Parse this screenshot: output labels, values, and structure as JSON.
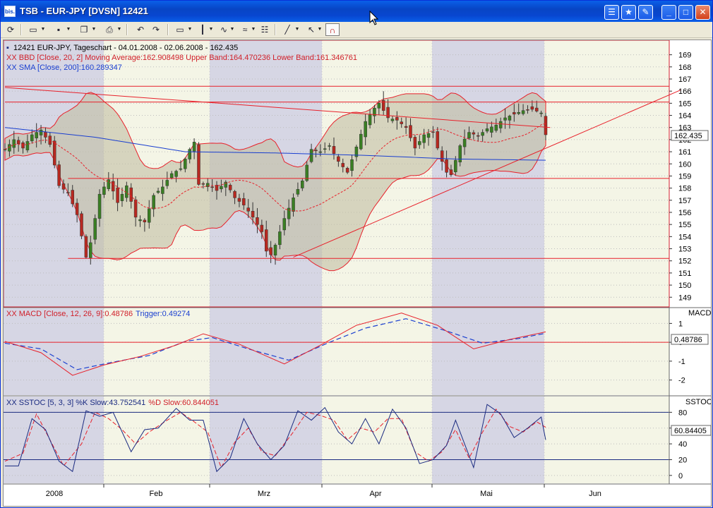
{
  "window": {
    "title": "TSB - EUR-JPY [DVSN] 12421",
    "app_icon": "bis."
  },
  "colors": {
    "title_bar": "#0a5fe8",
    "price_red": "#e8202a",
    "sma_blue": "#1a3fd0",
    "band_fill": "#c4c0a4",
    "shade_gray": "#d6d6e4",
    "shade_cream": "#f4f5e6",
    "up_candle": "#3a7f23",
    "down_candle": "#b82820"
  },
  "toolbar": {
    "icons": [
      "refresh-icon",
      "open-folder-icon",
      "save-icon",
      "copy-icon",
      "print-icon",
      "undo-icon",
      "redo-icon",
      "chart-type-icon",
      "candle-icon",
      "indicator-icon",
      "compare-icon",
      "properties-icon",
      "draw-line-icon",
      "pointer-icon",
      "magnet-icon"
    ]
  },
  "main": {
    "legend_title": "12421  EUR-JPY, Tageschart - 04.01.2008 - 02.06.2008 - 162.435",
    "legend_bbd": "XX BBD [Close, 20, 2] Moving Average:162.908498 Upper Band:164.470236 Lower Band:161.346761",
    "legend_sma": "XX SMA [Close, 200]:160.289347",
    "last_price": "162.435"
  },
  "macd": {
    "panel_label": "MACD",
    "legend_name": "XX MACD [Close, 12, 26, 9]:0.48786",
    "legend_trigger": "Trigger:0.49274",
    "last_value": "0.48786"
  },
  "sstoc": {
    "panel_label": "SSTOC",
    "legend_k": "XX SSTOC [5, 3, 3] %K Slow:43.752541",
    "legend_d": "%D Slow:60.844051",
    "last_value": "60.84405"
  },
  "chart_data": [
    {
      "type": "line",
      "title": "12421  EUR-JPY, Tageschart - 04.01.2008 - 02.06.2008 - 162.435",
      "xlabel": "",
      "ylabel": "",
      "x_axis_labels": [
        "2008",
        "Feb",
        "Mrz",
        "Apr",
        "Mai",
        "Jun"
      ],
      "y_axis": {
        "ticks": [
          149,
          150,
          151,
          152,
          153,
          154,
          155,
          156,
          157,
          158,
          159,
          160,
          161,
          162,
          163,
          164,
          165,
          166,
          167,
          168,
          169
        ],
        "ylim": [
          148.2,
          170.2
        ],
        "position": "right",
        "grid": true
      },
      "series": [
        {
          "name": "XX BBD [Close, 20, 2] Moving Average",
          "last_value": 162.908498
        },
        {
          "name": "Upper Band",
          "last_value": 164.470236
        },
        {
          "name": "Lower Band",
          "last_value": 161.346761
        },
        {
          "name": "XX SMA [Close, 200]",
          "last_value": 160.289347
        }
      ],
      "close_path": [
        [
          0,
          161.2
        ],
        [
          2,
          162.0
        ],
        [
          4,
          161.3
        ],
        [
          6,
          162.4
        ],
        [
          8,
          162.8
        ],
        [
          10,
          161.6
        ],
        [
          12,
          158.2
        ],
        [
          14,
          157.6
        ],
        [
          16,
          155.8
        ],
        [
          18,
          152.3
        ],
        [
          19,
          153.5
        ],
        [
          21,
          157.5
        ],
        [
          23,
          158.7
        ],
        [
          25,
          156.8
        ],
        [
          27,
          158.2
        ],
        [
          29,
          155.6
        ],
        [
          31,
          155.2
        ],
        [
          33,
          157.4
        ],
        [
          35,
          158.1
        ],
        [
          37,
          159.2
        ],
        [
          39,
          159.6
        ],
        [
          41,
          161.2
        ],
        [
          42,
          161.8
        ],
        [
          43,
          158.3
        ],
        [
          45,
          158.4
        ],
        [
          47,
          157.8
        ],
        [
          49,
          158.5
        ],
        [
          51,
          157.2
        ],
        [
          53,
          156.6
        ],
        [
          55,
          155.6
        ],
        [
          57,
          154.4
        ],
        [
          58,
          152.8
        ],
        [
          59,
          152.5
        ],
        [
          60,
          153.3
        ],
        [
          62,
          155.5
        ],
        [
          64,
          157.2
        ],
        [
          66,
          158.6
        ],
        [
          68,
          161.2
        ],
        [
          70,
          161.0
        ],
        [
          72,
          161.5
        ],
        [
          74,
          160.2
        ],
        [
          76,
          159.3
        ],
        [
          78,
          161.4
        ],
        [
          80,
          163.5
        ],
        [
          82,
          164.6
        ],
        [
          83,
          165.0
        ],
        [
          85,
          163.8
        ],
        [
          87,
          163.6
        ],
        [
          89,
          163.0
        ],
        [
          91,
          161.3
        ],
        [
          93,
          162.4
        ],
        [
          95,
          162.6
        ],
        [
          96,
          161.3
        ],
        [
          97,
          160.2
        ],
        [
          98,
          159.3
        ],
        [
          99,
          159.1
        ],
        [
          101,
          161.5
        ],
        [
          103,
          162.6
        ],
        [
          105,
          162.3
        ],
        [
          107,
          162.9
        ],
        [
          109,
          163.2
        ],
        [
          111,
          163.8
        ],
        [
          113,
          164.1
        ],
        [
          115,
          164.4
        ],
        [
          117,
          164.5
        ],
        [
          119,
          164.2
        ],
        [
          120,
          162.4
        ]
      ],
      "horizontal_lines": [
        166.4,
        165.1,
        158.8,
        152.2
      ],
      "trendlines": [
        {
          "from": [
            0,
            166.3
          ],
          "to": [
            121,
            163.0
          ]
        },
        {
          "from": [
            64,
            152.3
          ],
          "to": [
            150,
            166.1
          ]
        }
      ]
    },
    {
      "type": "line",
      "title": "XX MACD [Close, 12, 26, 9]:0.48786",
      "y_axis": {
        "ticks": [
          -2,
          -1,
          0,
          1
        ],
        "ylim": [
          -2.8,
          1.8
        ],
        "position": "right"
      },
      "series": [
        {
          "name": "XX MACD [Close, 12, 26, 9]",
          "last_value": 0.48786,
          "points": [
            [
              0,
              0.05
            ],
            [
              8,
              -0.55
            ],
            [
              15,
              -1.75
            ],
            [
              22,
              -1.2
            ],
            [
              30,
              -0.75
            ],
            [
              38,
              -0.15
            ],
            [
              44,
              0.45
            ],
            [
              52,
              -0.1
            ],
            [
              62,
              -1.15
            ],
            [
              70,
              -0.15
            ],
            [
              78,
              0.9
            ],
            [
              88,
              1.55
            ],
            [
              96,
              0.9
            ],
            [
              104,
              -0.35
            ],
            [
              112,
              0.15
            ],
            [
              120,
              0.55
            ]
          ]
        },
        {
          "name": "Trigger",
          "last_value": 0.49274,
          "points": [
            [
              0,
              -0.05
            ],
            [
              8,
              -0.35
            ],
            [
              16,
              -1.45
            ],
            [
              24,
              -1.05
            ],
            [
              32,
              -0.7
            ],
            [
              40,
              0.05
            ],
            [
              46,
              0.25
            ],
            [
              54,
              -0.35
            ],
            [
              63,
              -0.95
            ],
            [
              72,
              0.0
            ],
            [
              80,
              0.75
            ],
            [
              89,
              1.25
            ],
            [
              98,
              0.6
            ],
            [
              106,
              -0.05
            ],
            [
              114,
              0.2
            ],
            [
              120,
              0.48
            ]
          ]
        }
      ],
      "horizontal_lines": [
        0
      ]
    },
    {
      "type": "line",
      "title": "XX SSTOC [5, 3, 3] %K Slow:43.752541",
      "y_axis": {
        "ticks": [
          0,
          20,
          40,
          60,
          80
        ],
        "ylim": [
          -10,
          100
        ],
        "position": "right"
      },
      "series": [
        {
          "name": "%K Slow",
          "last_value": 43.752541,
          "points": [
            [
              0,
              12
            ],
            [
              3,
              12
            ],
            [
              6,
              72
            ],
            [
              9,
              58
            ],
            [
              12,
              18
            ],
            [
              15,
              5
            ],
            [
              18,
              82
            ],
            [
              21,
              75
            ],
            [
              24,
              80
            ],
            [
              28,
              30
            ],
            [
              31,
              58
            ],
            [
              34,
              60
            ],
            [
              38,
              85
            ],
            [
              41,
              70
            ],
            [
              44,
              70
            ],
            [
              47,
              5
            ],
            [
              50,
              22
            ],
            [
              53,
              72
            ],
            [
              56,
              40
            ],
            [
              59,
              20
            ],
            [
              62,
              38
            ],
            [
              65,
              82
            ],
            [
              68,
              70
            ],
            [
              71,
              86
            ],
            [
              74,
              55
            ],
            [
              77,
              40
            ],
            [
              80,
              72
            ],
            [
              83,
              40
            ],
            [
              86,
              84
            ],
            [
              89,
              60
            ],
            [
              92,
              15
            ],
            [
              95,
              20
            ],
            [
              98,
              38
            ],
            [
              100,
              70
            ],
            [
              104,
              10
            ],
            [
              107,
              90
            ],
            [
              110,
              78
            ],
            [
              113,
              48
            ],
            [
              116,
              60
            ],
            [
              119,
              74
            ],
            [
              120,
              45
            ]
          ]
        },
        {
          "name": "%D Slow",
          "last_value": 60.844051,
          "points": [
            [
              0,
              18
            ],
            [
              4,
              28
            ],
            [
              7,
              78
            ],
            [
              10,
              45
            ],
            [
              13,
              12
            ],
            [
              17,
              40
            ],
            [
              20,
              80
            ],
            [
              23,
              72
            ],
            [
              26,
              58
            ],
            [
              29,
              40
            ],
            [
              32,
              55
            ],
            [
              36,
              70
            ],
            [
              39,
              80
            ],
            [
              42,
              68
            ],
            [
              45,
              55
            ],
            [
              48,
              10
            ],
            [
              51,
              42
            ],
            [
              54,
              60
            ],
            [
              57,
              30
            ],
            [
              60,
              25
            ],
            [
              64,
              55
            ],
            [
              67,
              80
            ],
            [
              70,
              76
            ],
            [
              73,
              70
            ],
            [
              76,
              45
            ],
            [
              79,
              60
            ],
            [
              82,
              55
            ],
            [
              85,
              72
            ],
            [
              88,
              72
            ],
            [
              91,
              30
            ],
            [
              94,
              18
            ],
            [
              97,
              30
            ],
            [
              100,
              58
            ],
            [
              103,
              22
            ],
            [
              106,
              55
            ],
            [
              109,
              84
            ],
            [
              112,
              62
            ],
            [
              115,
              55
            ],
            [
              118,
              68
            ],
            [
              120,
              61
            ]
          ]
        }
      ],
      "horizontal_lines": [
        20,
        80
      ]
    }
  ]
}
